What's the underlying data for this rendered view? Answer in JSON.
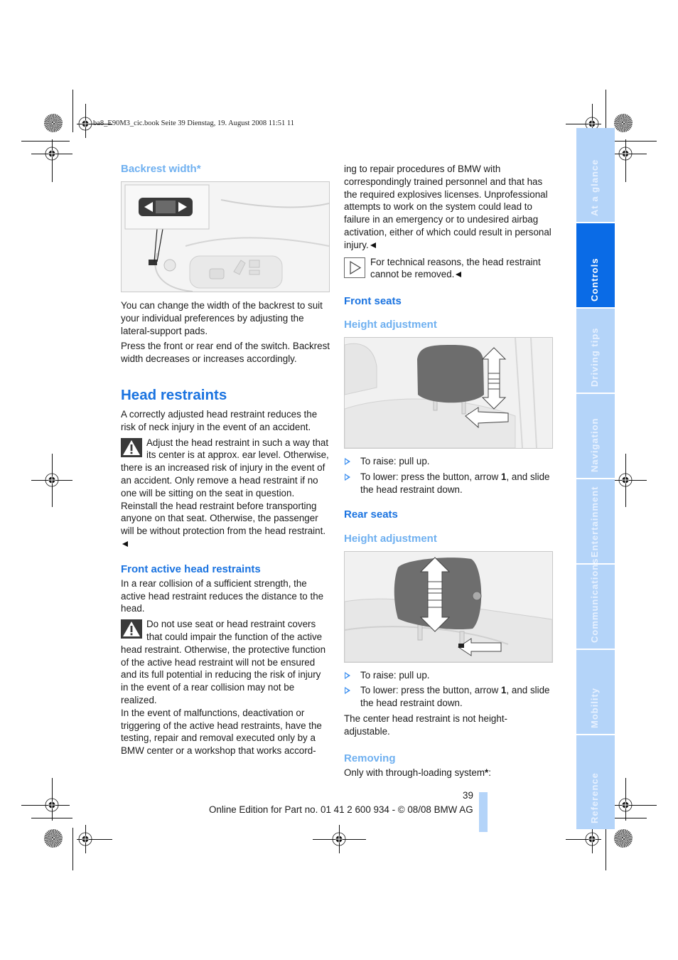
{
  "slug_line": "ba8_E90M3_cic.book  Seite 39  Dienstag, 19. August 2008  11:51 11",
  "left_column": {
    "backrest": {
      "heading": "Backrest width*",
      "figure_icon": "seat-width-switch-illustration",
      "para1": "You can change the width of the backrest to suit your individual preferences by adjusting the lateral-support pads.",
      "para2": "Press the front or rear end of the switch. Backrest width decreases or increases accordingly."
    },
    "head_restraints": {
      "heading": "Head restraints",
      "intro": "A correctly adjusted head restraint reduces the risk of neck injury in the event of an accident.",
      "warning1": "Adjust the head restraint in such a way that its center is at approx. ear level. Otherwise, there is an increased risk of injury in the event of an accident. Only remove a head restraint if no one will be sitting on the seat in question. Reinstall the head restraint before transporting anyone on that seat. Otherwise, the passenger will be without protection from the head restraint."
    },
    "front_active": {
      "heading": "Front active head restraints",
      "intro": "In a rear collision of a sufficient strength, the active head restraint reduces the distance to the head.",
      "warning2": "Do not use seat or head restraint covers that could impair the function of the active head restraint. Otherwise, the protective function of the active head restraint will not be ensured and its full potential in reducing the risk of injury in the event of a rear collision may not be realized.",
      "malfunction": "In the event of malfunctions, deactivation or triggering of the active head restraints, have the testing, repair and removal executed only by a BMW center or a workshop that works accord-"
    }
  },
  "right_column": {
    "continuation": "ing to repair procedures of BMW with correspondingly trained personnel and that has the required explosives licenses. Unprofessional attempts to work on the system could lead to failure in an emergency or to undesired airbag activation, either of which could result in personal injury.",
    "note": "For technical reasons, the head restraint cannot be removed.",
    "front_seats": {
      "heading": "Front seats",
      "subheading": "Height adjustment",
      "figure_icon": "front-head-restraint-illustration",
      "bullets": [
        {
          "pre": "To raise: pull up.",
          "bold": "",
          "post": ""
        },
        {
          "pre": "To lower: press the button, arrow ",
          "bold": "1",
          "post": ", and slide the head restraint down."
        }
      ]
    },
    "rear_seats": {
      "heading": "Rear seats",
      "subheading": "Height adjustment",
      "figure_icon": "rear-head-restraint-illustration",
      "bullets": [
        {
          "pre": "To raise: pull up.",
          "bold": "",
          "post": ""
        },
        {
          "pre": "To lower: press the button, arrow ",
          "bold": "1",
          "post": ", and slide the head restraint down."
        }
      ],
      "center_note": "The center head restraint is not height-adjustable."
    },
    "removing": {
      "heading": "Removing",
      "text_pre": "Only with through-loading system",
      "text_star": "*",
      "text_post": ":"
    }
  },
  "footer": {
    "page_number": "39",
    "edition": "Online Edition for Part no. 01 41 2 600 934 - © 08/08 BMW AG"
  },
  "side_tabs": [
    {
      "label": "At a glance",
      "active": false
    },
    {
      "label": "Controls",
      "active": true
    },
    {
      "label": "Driving tips",
      "active": false
    },
    {
      "label": "Navigation",
      "active": false
    },
    {
      "label": "Entertainment",
      "active": false
    },
    {
      "label": "Communications",
      "active": false
    },
    {
      "label": "Mobility",
      "active": false
    },
    {
      "label": "Reference",
      "active": false
    }
  ],
  "colors": {
    "heading_blue": "#1a73e0",
    "subheading_blue": "#6fb0f0",
    "tab_active": "#0a6be6",
    "tab_inactive": "#b4d4f9"
  }
}
